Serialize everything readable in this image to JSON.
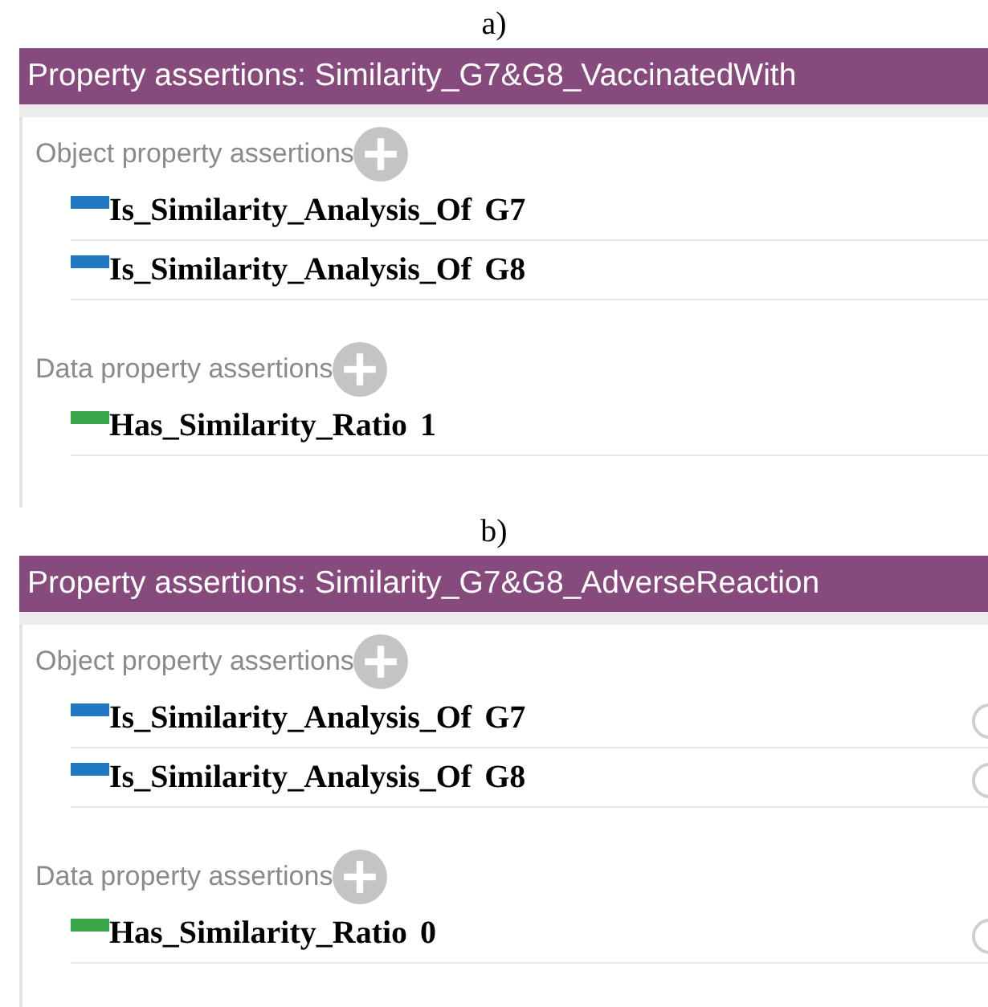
{
  "panels": [
    {
      "caption": "a)",
      "title": "Property assertions: Similarity_G7&G8_VaccinatedWith",
      "row_actions_shown": false,
      "sections": [
        {
          "heading": "Object property assertions",
          "items": [
            {
              "property": "Is_Similarity_Analysis_Of",
              "value": "G7",
              "color": "#1f78c1"
            },
            {
              "property": "Is_Similarity_Analysis_Of",
              "value": "G8",
              "color": "#1f78c1"
            }
          ]
        },
        {
          "heading": "Data property assertions",
          "items": [
            {
              "property": "Has_Similarity_Ratio",
              "value": "1",
              "color": "#3aa64a"
            }
          ]
        }
      ]
    },
    {
      "caption": "b)",
      "title": "Property assertions: Similarity_G7&G8_AdverseReaction",
      "row_actions_shown": true,
      "sections": [
        {
          "heading": "Object property assertions",
          "items": [
            {
              "property": "Is_Similarity_Analysis_Of",
              "value": "G7",
              "color": "#1f78c1"
            },
            {
              "property": "Is_Similarity_Analysis_Of",
              "value": "G8",
              "color": "#1f78c1"
            }
          ]
        },
        {
          "heading": "Data property assertions",
          "items": [
            {
              "property": "Has_Similarity_Ratio",
              "value": "0",
              "color": "#3aa64a"
            }
          ]
        }
      ]
    }
  ]
}
